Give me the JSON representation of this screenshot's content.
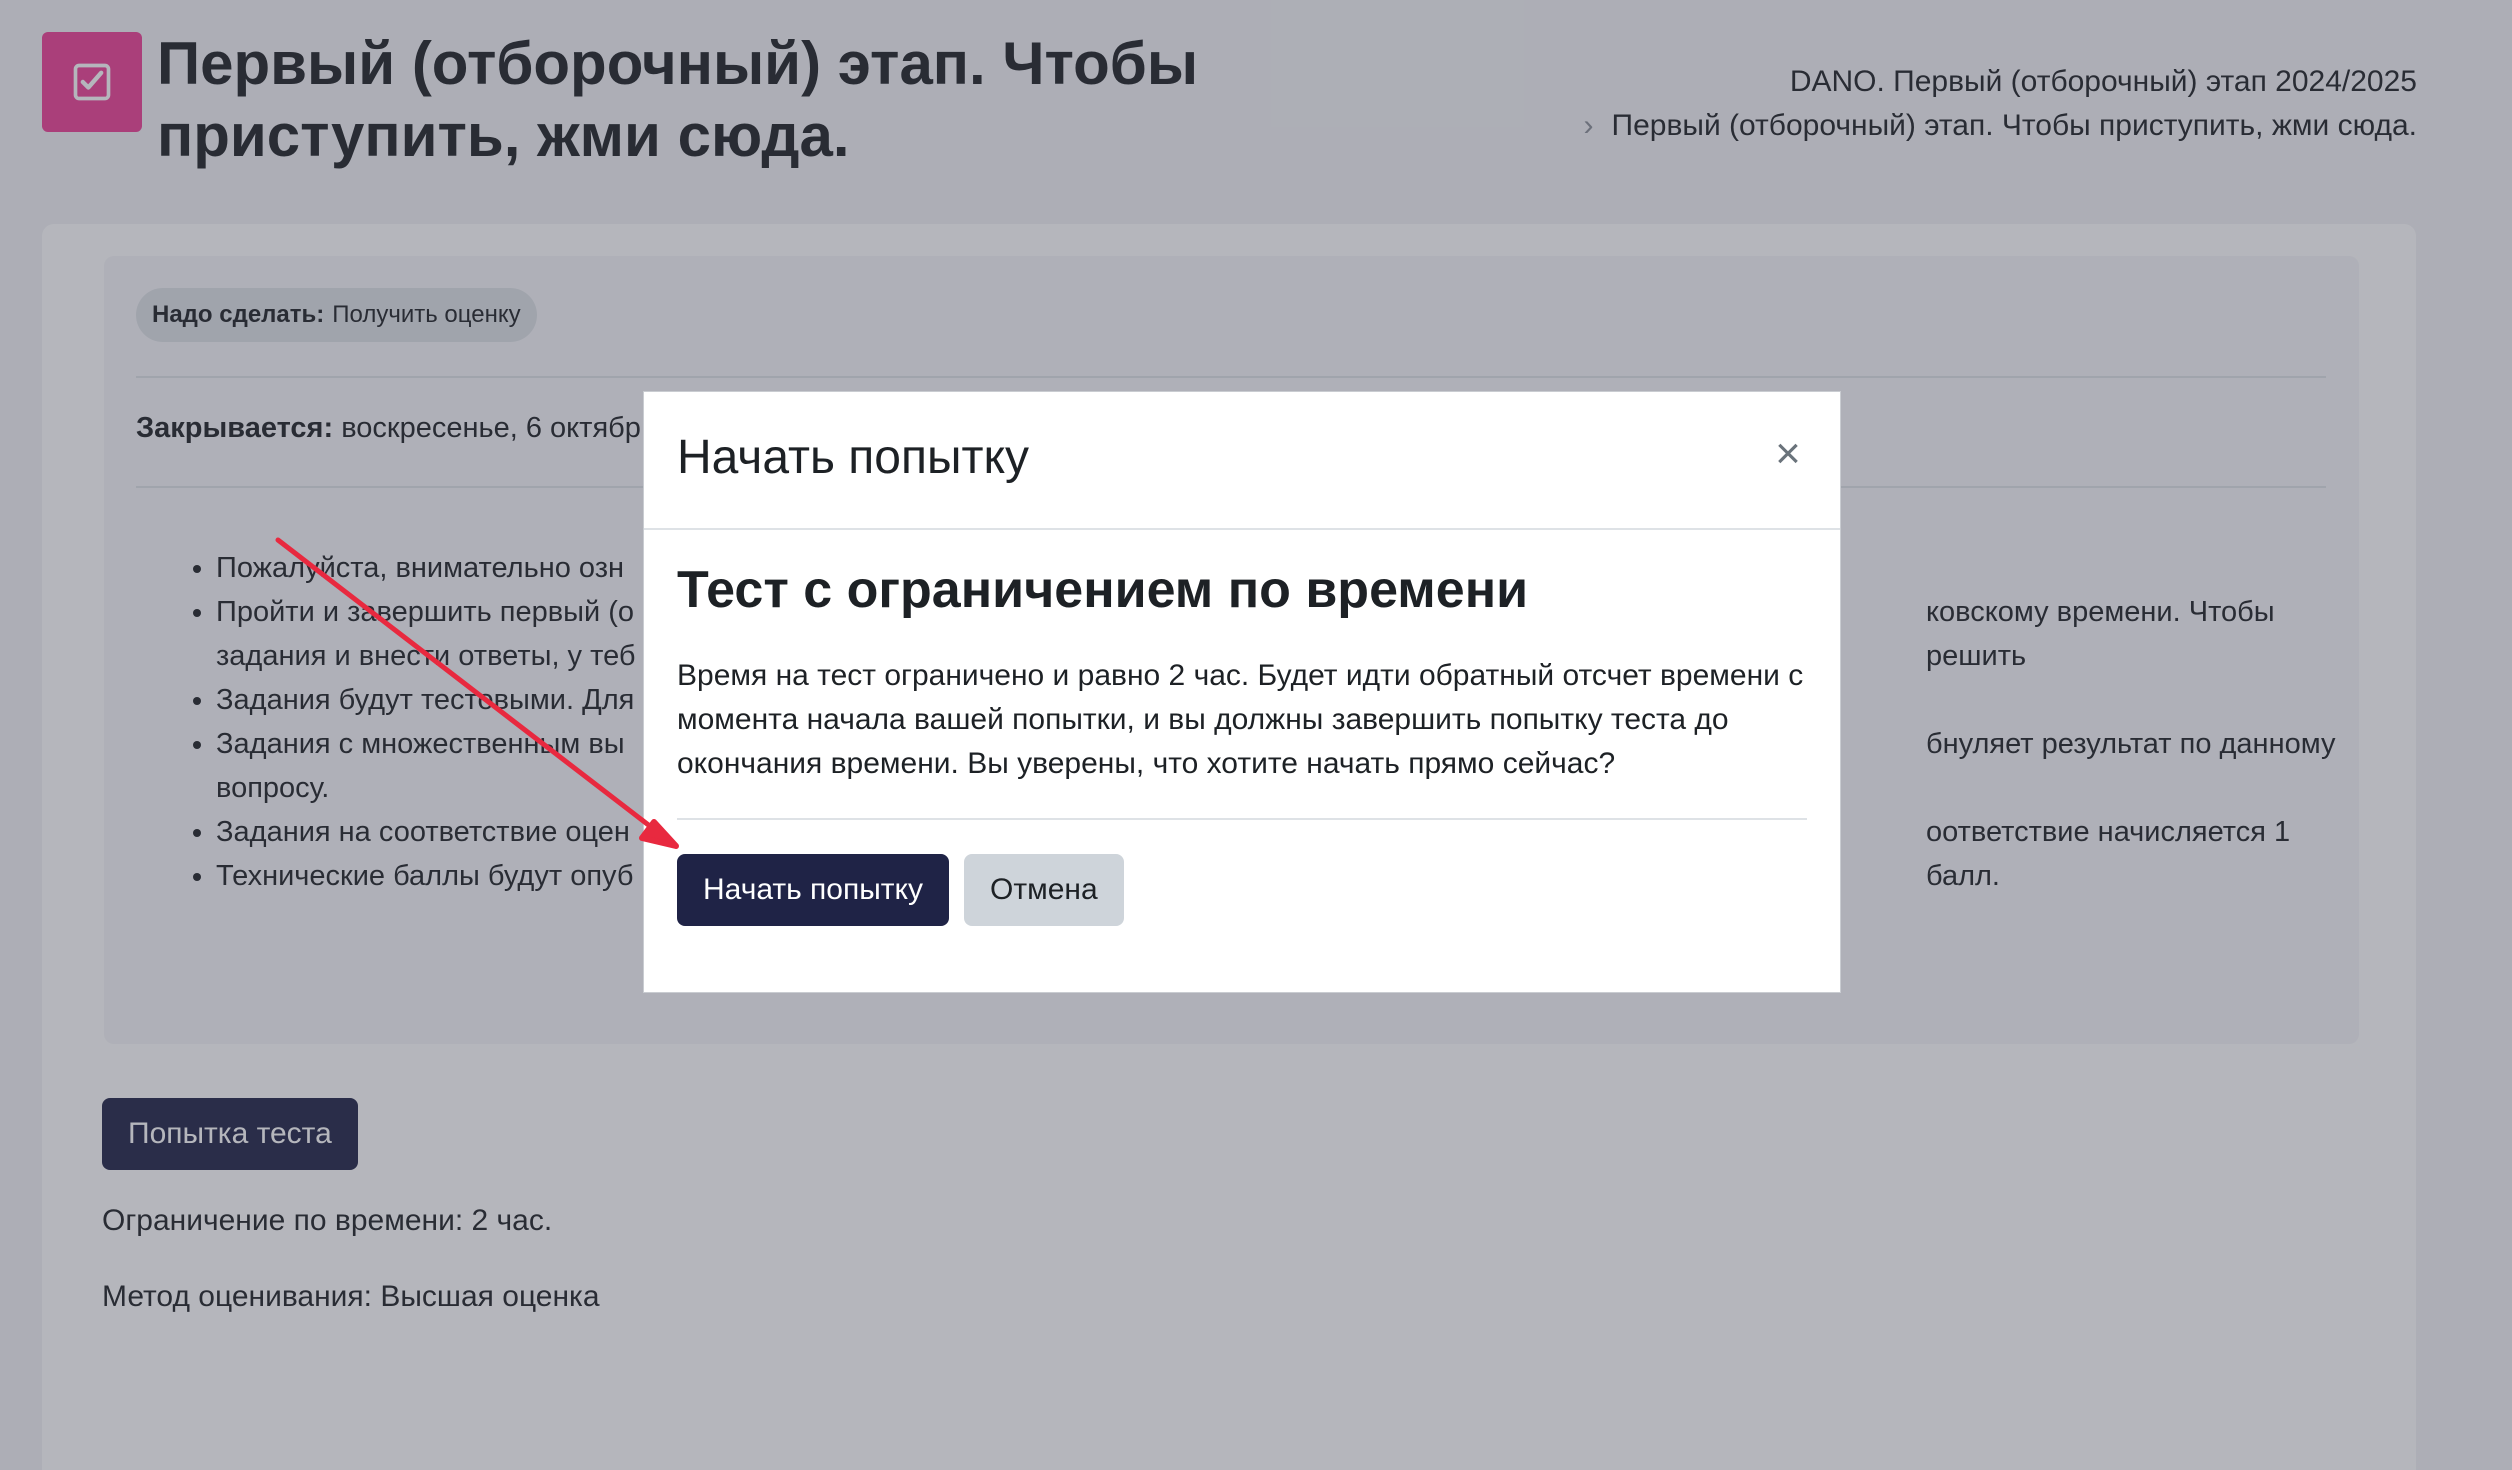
{
  "header": {
    "title": "Первый (отборочный) этап. Чтобы приступить, жми сюда.",
    "breadcrumb": [
      "DANO. Первый (отборочный) этап 2024/2025",
      "Первый (отборочный) этап. Чтобы приступить, жми сюда."
    ],
    "icon": "checkbox-icon",
    "accent_color": "#ee3f95"
  },
  "activity": {
    "todo_label": "Надо сделать:",
    "todo_value": "Получить оценку",
    "closes_label": "Закрывается:",
    "closes_value": "воскресенье, 6 октябр",
    "rules": [
      {
        "left": "Пожалуйста, внимательно озн",
        "right": ""
      },
      {
        "left": "Пройти и завершить первый (о",
        "right": "ковскому времени. Чтобы решить"
      },
      {
        "left": "задания и внести ответы, у теб",
        "right": ""
      },
      {
        "left": "Задания будут тестовыми. Для",
        "right": ""
      },
      {
        "left": "Задания с множественным вы",
        "right": "бнуляет результат по данному"
      },
      {
        "left": "вопросу.",
        "right": ""
      },
      {
        "left": "Задания на соответствие оцен",
        "right": "оответствие начисляется 1 балл."
      },
      {
        "left": "Технические баллы будут опуб",
        "right": ""
      }
    ],
    "attempt_button": "Попытка теста",
    "time_limit": "Ограничение по времени: 2 час.",
    "grading_method": "Метод оценивания: Высшая оценка"
  },
  "modal": {
    "title": "Начать попытку",
    "close_glyph": "×",
    "heading": "Тест с ограничением по времени",
    "text": "Время на тест ограничено и равно 2 час. Будет идти обратный отсчет времени с момента начала вашей попытки, и вы должны завершить попытку теста до окончания времени. Вы уверены, что хотите начать прямо сейчас?",
    "start_button": "Начать попытку",
    "cancel_button": "Отмена",
    "primary_color": "#1f2346"
  },
  "annotation": {
    "arrow_color": "#e8293f"
  }
}
